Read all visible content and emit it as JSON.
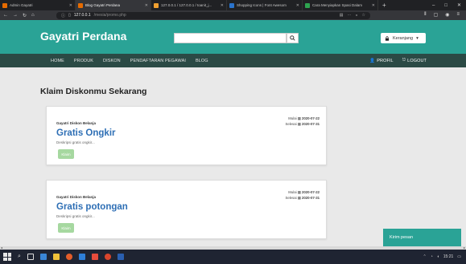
{
  "browser": {
    "tabs": [
      {
        "label": "Admin Gayatri",
        "active": false,
        "favicon_color": "#e66b00"
      },
      {
        "label": "Blog Gayatri Perdana",
        "active": true,
        "favicon_color": "#e66b00"
      },
      {
        "label": "127.0.0.1 / 127.0.0.1 / toanit_j...",
        "active": false,
        "favicon_color": "#f0a030"
      },
      {
        "label": "Shopping Icons | Font Awesom",
        "active": false,
        "favicon_color": "#2a73cc"
      },
      {
        "label": "Cara Menyiapkan Spasi Dalam",
        "active": false,
        "favicon_color": "#2ea44f"
      }
    ],
    "url_host": "127.0.0.1",
    "url_path": "/mesia/promo.php"
  },
  "header": {
    "brand": "Gayatri Perdana",
    "search_placeholder": "",
    "cart_label": "Keranjang"
  },
  "nav": {
    "items": [
      "HOME",
      "PRODUK",
      "DISKON",
      "PENDAFTARAN PEGAWAI",
      "BLOG"
    ],
    "profile": "PROFIL",
    "logout": "LOGOUT"
  },
  "main": {
    "title": "Klaim Diskonmu Sekarang",
    "promos": [
      {
        "subtitle": "Gayatri Diskon Belanja",
        "start_label": "Mulai",
        "start": "2020-07-22",
        "end_label": "Selesai",
        "end": "2020-07-31",
        "name": "Gratis Ongkir",
        "desc": "Deskripsi gratis ongkir...",
        "button": "Klaim"
      },
      {
        "subtitle": "Gayatri Diskon Belanja",
        "start_label": "Mulai",
        "start": "2020-07-22",
        "end_label": "Selesai",
        "end": "2020-07-31",
        "name": "Gratis potongan",
        "desc": "Deskripsi gratis ongkir...",
        "button": "Klaim"
      }
    ]
  },
  "chat": {
    "label": "Kirim pesan"
  },
  "taskbar": {
    "time": "15:21"
  },
  "colors": {
    "header": "#2aa396",
    "nav": "#2b4a45",
    "promo_title": "#2e6fb5",
    "claim_button": "#a6d8a0"
  }
}
